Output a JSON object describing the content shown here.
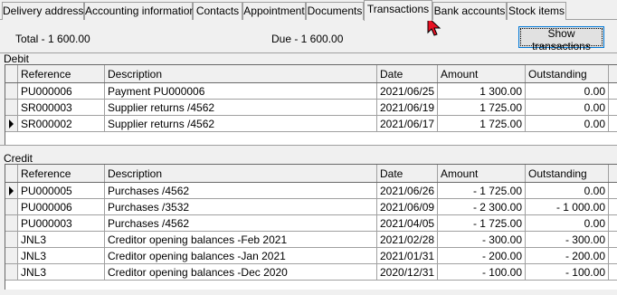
{
  "tabs": [
    {
      "label": "Delivery address",
      "active": false
    },
    {
      "label": "Accounting information",
      "active": false
    },
    {
      "label": "Contacts",
      "active": false
    },
    {
      "label": "Appointment",
      "active": false
    },
    {
      "label": "Documents",
      "active": false
    },
    {
      "label": "Transactions",
      "active": true
    },
    {
      "label": "Bank accounts",
      "active": false
    },
    {
      "label": "Stock items",
      "active": false
    }
  ],
  "summary": {
    "total": "Total - 1 600.00",
    "due": "Due - 1 600.00",
    "show_button": "Show transactions"
  },
  "columns": {
    "reference": "Reference",
    "description": "Description",
    "date": "Date",
    "amount": "Amount",
    "outstanding": "Outstanding"
  },
  "debit": {
    "label": "Debit",
    "rows": [
      {
        "reference": "PU000006",
        "description": "Payment PU000006",
        "date": "2021/06/25",
        "amount": "1 300.00",
        "outstanding": "0.00",
        "current": false
      },
      {
        "reference": "SR000003",
        "description": "Supplier returns /4562",
        "date": "2021/06/19",
        "amount": "1 725.00",
        "outstanding": "0.00",
        "current": false
      },
      {
        "reference": "SR000002",
        "description": "Supplier returns /4562",
        "date": "2021/06/17",
        "amount": "1 725.00",
        "outstanding": "0.00",
        "current": true
      }
    ]
  },
  "credit": {
    "label": "Credit",
    "rows": [
      {
        "reference": "PU000005",
        "description": "Purchases /4562",
        "date": "2021/06/26",
        "amount": "- 1 725.00",
        "outstanding": "0.00",
        "current": true
      },
      {
        "reference": "PU000006",
        "description": "Purchases /3532",
        "date": "2021/06/09",
        "amount": "- 2 300.00",
        "outstanding": "- 1 000.00",
        "current": false
      },
      {
        "reference": "PU000003",
        "description": "Purchases /4562",
        "date": "2021/04/05",
        "amount": "- 1 725.00",
        "outstanding": "0.00",
        "current": false
      },
      {
        "reference": "JNL3",
        "description": "Creditor opening balances -Feb 2021",
        "date": "2021/02/28",
        "amount": "- 300.00",
        "outstanding": "- 300.00",
        "current": false
      },
      {
        "reference": "JNL3",
        "description": "Creditor opening balances -Jan 2021",
        "date": "2021/01/31",
        "amount": "- 200.00",
        "outstanding": "- 200.00",
        "current": false
      },
      {
        "reference": "JNL3",
        "description": "Creditor opening balances -Dec 2020",
        "date": "2020/12/31",
        "amount": "- 100.00",
        "outstanding": "- 100.00",
        "current": false
      }
    ]
  },
  "colors": {
    "window_bg": "#f0f0f0",
    "grid_bg": "#ffffff",
    "button_focus_border": "#0078d7",
    "cursor_fill": "#e81123"
  },
  "icons": {
    "row_indicator": "row-indicator-arrow-icon",
    "mouse_pointer": "mouse-pointer-icon"
  }
}
